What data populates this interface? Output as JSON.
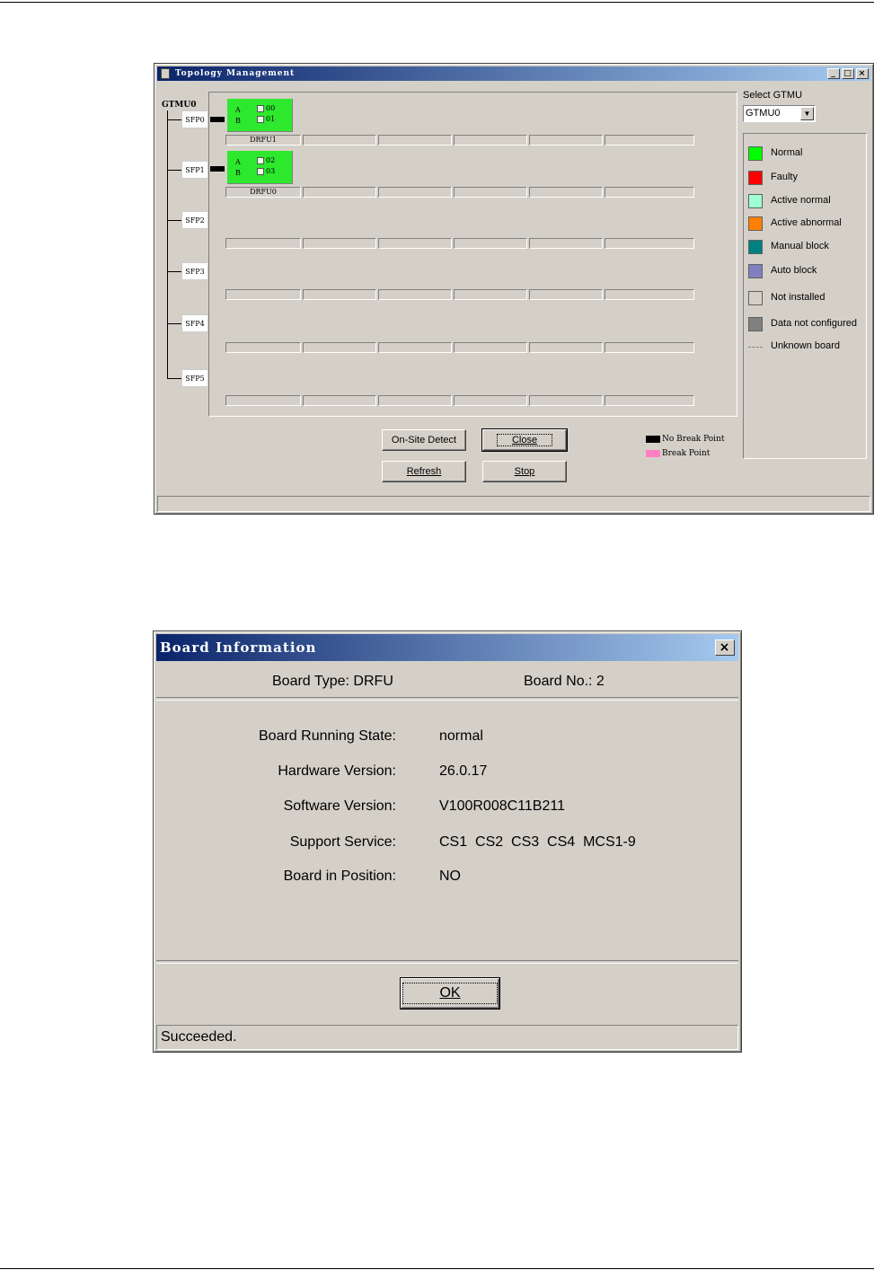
{
  "topology": {
    "title": "Topology Management",
    "root": "GTMU0",
    "sfps": [
      {
        "label": "SFP0",
        "board": {
          "name": "DRFU1",
          "ports": [
            "A",
            "B"
          ],
          "cells": [
            "00",
            "01"
          ],
          "status": "Normal"
        }
      },
      {
        "label": "SFP1",
        "board": {
          "name": "DRFU0",
          "ports": [
            "A",
            "B"
          ],
          "cells": [
            "02",
            "03"
          ],
          "status": "Normal"
        }
      },
      {
        "label": "SFP2"
      },
      {
        "label": "SFP3"
      },
      {
        "label": "SFP4"
      },
      {
        "label": "SFP5"
      }
    ],
    "select_gtmu": {
      "label": "Select GTMU",
      "value": "GTMU0"
    },
    "legend": [
      {
        "label": "Normal",
        "color": "#00ff00"
      },
      {
        "label": "Faulty",
        "color": "#ff0000"
      },
      {
        "label": "Active normal",
        "color": "#a0ffd0"
      },
      {
        "label": "Active abnormal",
        "color": "#ff8000"
      },
      {
        "label": "Manual block",
        "color": "#008080"
      },
      {
        "label": "Auto block",
        "color": "#8080c0"
      },
      {
        "label": "Not installed",
        "color": "#d4d0c8"
      },
      {
        "label": "Data not configured",
        "color": "#808080"
      },
      {
        "label": "Unknown board",
        "color": "#808080"
      }
    ],
    "buttons": {
      "onsite": "On-Site Detect",
      "close": "Close",
      "refresh": "Refresh",
      "stop": "Stop"
    },
    "breakpoints": [
      {
        "label": "No Break Point",
        "color": "#000000"
      },
      {
        "label": "Break Point",
        "color": "#ff80c0"
      }
    ]
  },
  "board_info": {
    "title": "Board Information",
    "board_type": "Board Type: DRFU",
    "board_no": "Board No.: 2",
    "fields": [
      {
        "label": "Board Running State:",
        "value": "normal"
      },
      {
        "label": "Hardware Version:",
        "value": "26.0.17"
      },
      {
        "label": "Software Version:",
        "value": "V100R008C11B211"
      },
      {
        "label": "Support Service:",
        "value": "CS1  CS2  CS3  CS4  MCS1-9"
      },
      {
        "label": "Board in Position:",
        "value": "NO"
      }
    ],
    "ok": "OK",
    "status": "Succeeded."
  }
}
